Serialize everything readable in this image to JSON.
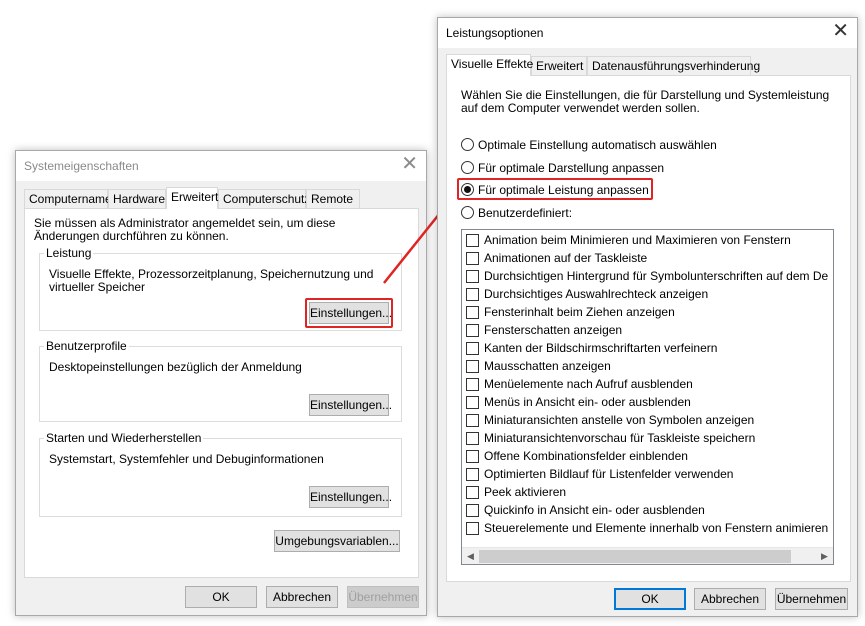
{
  "left_dialog": {
    "title": "Systemeigenschaften",
    "tabs": [
      "Computername",
      "Hardware",
      "Erweitert",
      "Computerschutz",
      "Remote"
    ],
    "active_tab": "Erweitert",
    "admin_note": "Sie müssen als Administrator angemeldet sein, um diese Änderungen durchführen zu können.",
    "groups": [
      {
        "label": "Leistung",
        "desc": "Visuelle Effekte, Prozessorzeitplanung, Speichernutzung und virtueller Speicher",
        "button": "Einstellungen..."
      },
      {
        "label": "Benutzerprofile",
        "desc": "Desktopeinstellungen bezüglich der Anmeldung",
        "button": "Einstellungen..."
      },
      {
        "label": "Starten und Wiederherstellen",
        "desc": "Systemstart, Systemfehler und Debuginformationen",
        "button": "Einstellungen..."
      }
    ],
    "env_button": "Umgebungsvariablen...",
    "ok": "OK",
    "cancel": "Abbrechen",
    "apply": "Übernehmen"
  },
  "right_dialog": {
    "title": "Leistungsoptionen",
    "tabs": [
      "Visuelle Effekte",
      "Erweitert",
      "Datenausführungsverhinderung"
    ],
    "active_tab": "Visuelle Effekte",
    "intro": "Wählen Sie die Einstellungen, die für Darstellung und Systemleistung auf dem Computer verwendet werden sollen.",
    "radios": [
      {
        "label": "Optimale Einstellung automatisch auswählen",
        "checked": false
      },
      {
        "label": "Für optimale Darstellung anpassen",
        "checked": false
      },
      {
        "label": "Für optimale Leistung anpassen",
        "checked": true
      },
      {
        "label": "Benutzerdefiniert:",
        "checked": false
      }
    ],
    "checkboxes": [
      "Animation beim Minimieren und Maximieren von Fenstern",
      "Animationen auf der Taskleiste",
      "Durchsichtigen Hintergrund für Symbolunterschriften auf dem De",
      "Durchsichtiges Auswahlrechteck anzeigen",
      "Fensterinhalt beim Ziehen anzeigen",
      "Fensterschatten anzeigen",
      "Kanten der Bildschirmschriftarten verfeinern",
      "Mausschatten anzeigen",
      "Menüelemente nach Aufruf ausblenden",
      "Menüs in Ansicht ein- oder ausblenden",
      "Miniaturansichten anstelle von Symbolen anzeigen",
      "Miniaturansichtenvorschau für Taskleiste speichern",
      "Offene Kombinationsfelder einblenden",
      "Optimierten Bildlauf für Listenfelder verwenden",
      "Peek aktivieren",
      "Quickinfo in Ansicht ein- oder ausblenden",
      "Steuerelemente und Elemente innerhalb von Fenstern animieren"
    ],
    "ok": "OK",
    "cancel": "Abbrechen",
    "apply": "Übernehmen"
  },
  "colors": {
    "highlight": "#e02424",
    "accent": "#0078d7"
  },
  "icons": {
    "close": "close-icon",
    "scroll_left": "chevron-left-icon",
    "scroll_right": "chevron-right-icon"
  }
}
